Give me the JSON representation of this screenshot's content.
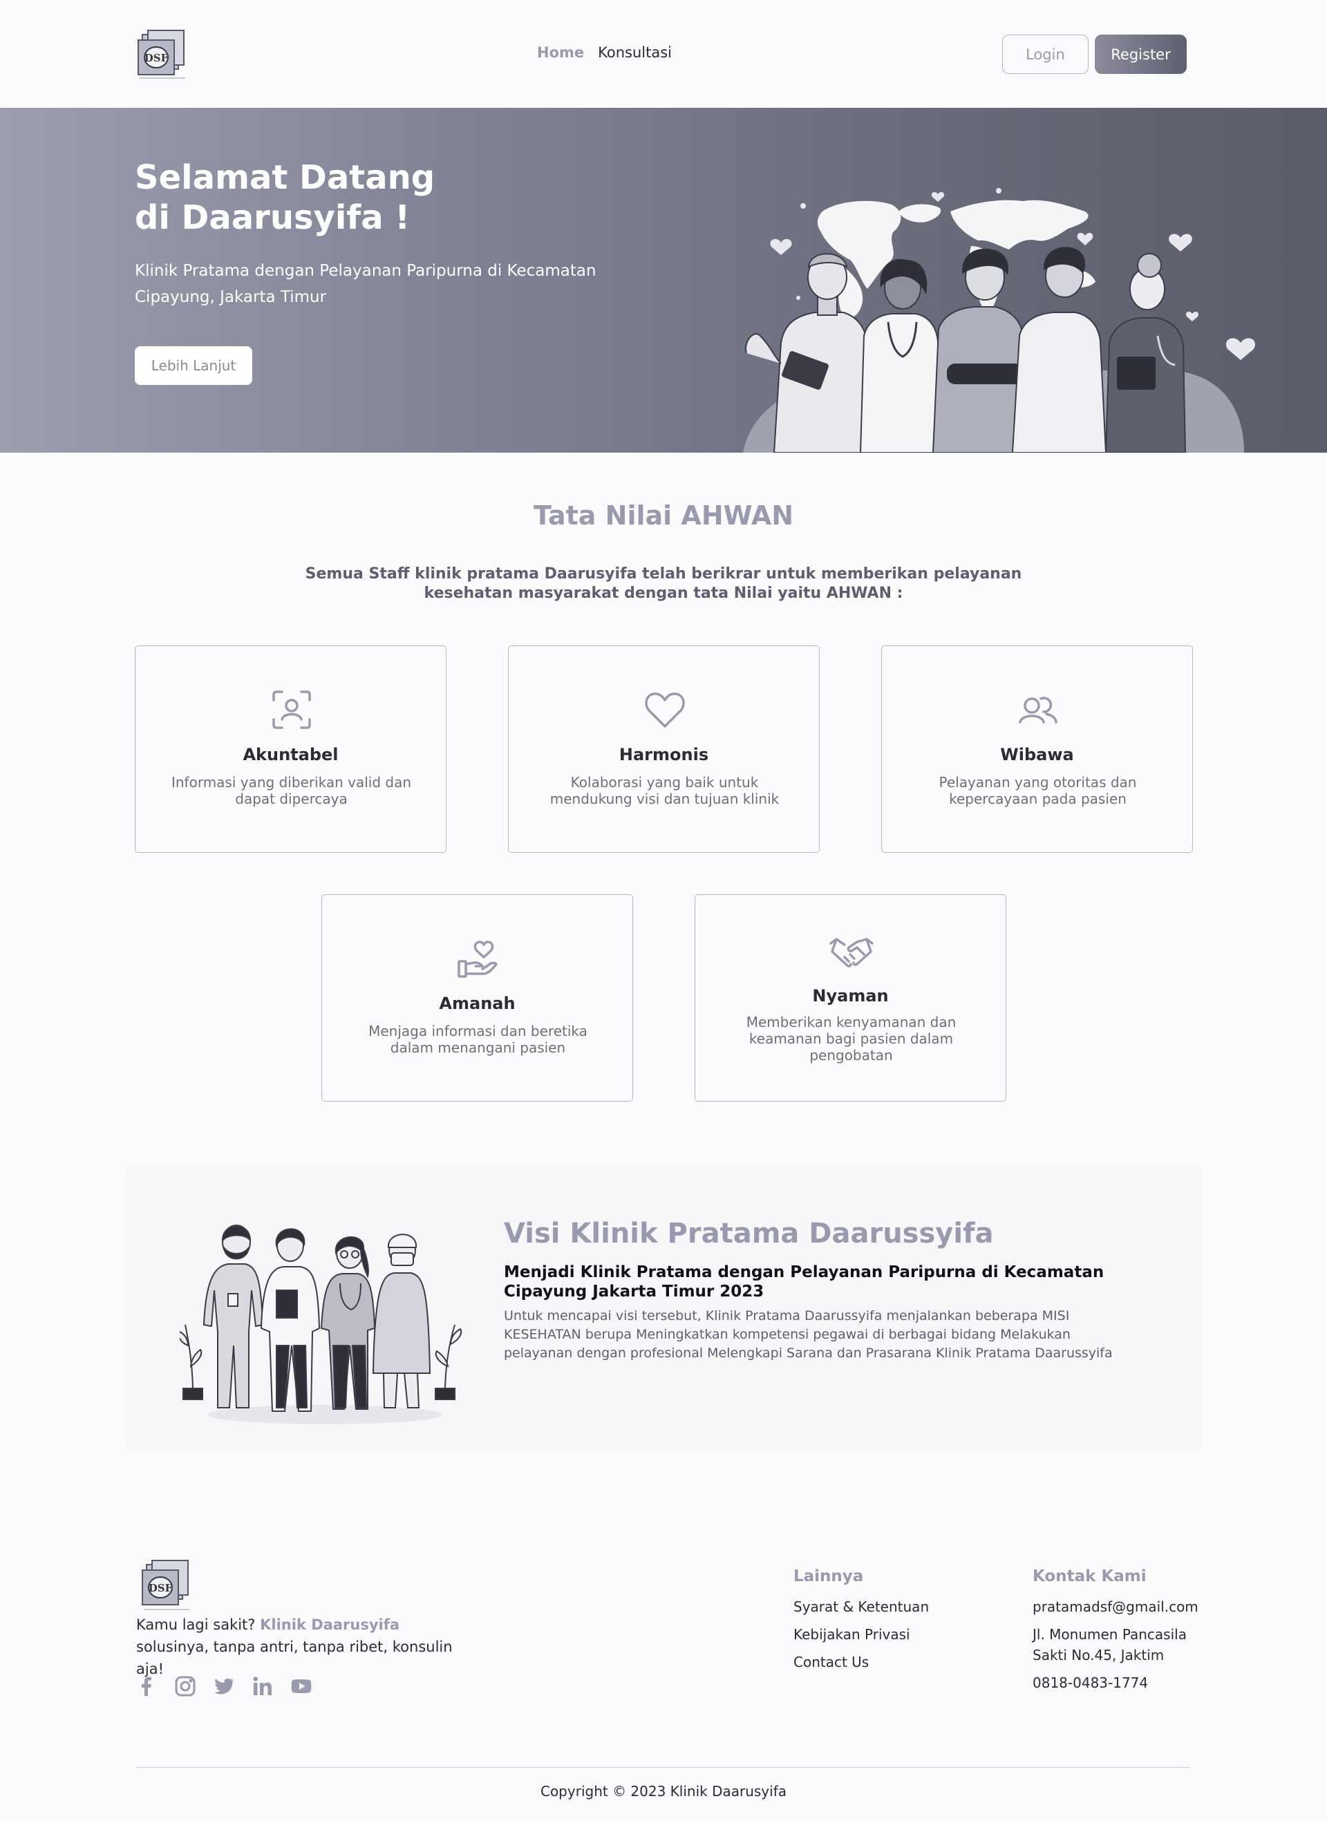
{
  "navbar": {
    "links": [
      "Home",
      "Konsultasi"
    ],
    "login_label": "Login",
    "register_label": "Register"
  },
  "hero": {
    "title_line1": "Selamat Datang",
    "title_line2": "di Daarusyifa !",
    "subtitle": "Klinik Pratama dengan Pelayanan Paripurna di Kecamatan Cipayung, Jakarta Timur",
    "cta_label": "Lebih Lanjut"
  },
  "values": {
    "title": "Tata Nilai AHWAN",
    "description": "Semua Staff klinik pratama Daarusyifa telah berikrar untuk memberikan pelayanan kesehatan masyarakat dengan tata Nilai yaitu AHWAN :",
    "cards": [
      {
        "icon": "user-focus-icon",
        "title": "Akuntabel",
        "desc": "Informasi yang diberikan valid dan dapat dipercaya"
      },
      {
        "icon": "heart-icon",
        "title": "Harmonis",
        "desc": "Kolaborasi yang baik untuk mendukung visi dan tujuan klinik"
      },
      {
        "icon": "users-icon",
        "title": "Wibawa",
        "desc": "Pelayanan yang otoritas dan kepercayaan pada pasien"
      },
      {
        "icon": "hand-heart-icon",
        "title": "Amanah",
        "desc": "Menjaga informasi dan beretika dalam menangani pasien"
      },
      {
        "icon": "handshake-icon",
        "title": "Nyaman",
        "desc": "Memberikan kenyamanan dan keamanan bagi pasien dalam pengobatan"
      }
    ]
  },
  "visi": {
    "title": "Visi Klinik Pratama Daarussyifa",
    "subtitle": "Menjadi Klinik Pratama dengan Pelayanan Paripurna di Kecamatan Cipayung Jakarta Timur 2023",
    "description": "Untuk mencapai visi tersebut, Klinik Pratama Daarussyifa menjalankan beberapa MISI KESEHATAN berupa Meningkatkan kompetensi pegawai di berbagai bidang Melakukan pelayanan dengan profesional Melengkapi Sarana dan Prasarana Klinik Pratama Daarussyifa"
  },
  "footer": {
    "tagline_prefix": "Kamu lagi sakit?",
    "tagline_brand": "Klinik Daarusyifa",
    "tagline_suffix": "solusinya, tanpa antri, tanpa ribet, konsulin aja!",
    "socials": [
      "facebook-icon",
      "instagram-icon",
      "twitter-icon",
      "linkedin-icon",
      "youtube-icon"
    ],
    "lainnya_title": "Lainnya",
    "lainnya_links": [
      "Syarat & Ketentuan",
      "Kebijakan Privasi",
      "Contact Us"
    ],
    "kontak_title": "Kontak Kami",
    "email": "pratamadsf@gmail.com",
    "address": "Jl. Monumen Pancasila Sakti No.45, Jaktim",
    "phone": "0818-0483-1774",
    "copyright": "Copyright © 2023 Klinik Daarusyifa"
  },
  "colors": {
    "accent": "#9a9aaf",
    "hero_start": "#9c9eae",
    "hero_end": "#5b5d6a",
    "card_border": "#b4b8c8"
  }
}
